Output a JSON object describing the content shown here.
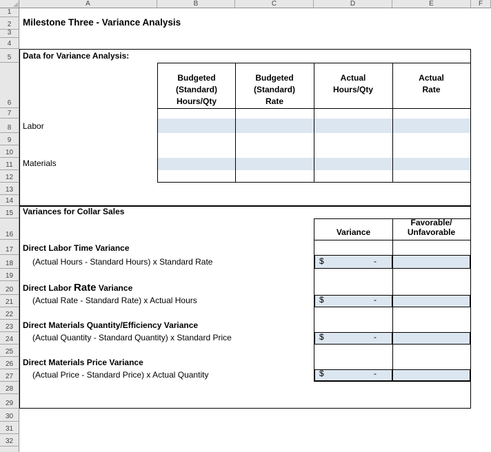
{
  "sheet": {
    "column_headers": [
      "A",
      "B",
      "C",
      "D",
      "E",
      "F"
    ],
    "row_headers": [
      "1",
      "2",
      "3",
      "4",
      "5",
      "6",
      "7",
      "8",
      "9",
      "10",
      "11",
      "12",
      "13",
      "14",
      "15",
      "16",
      "17",
      "18",
      "19",
      "20",
      "21",
      "22",
      "23",
      "24",
      "25",
      "26",
      "27",
      "28",
      "29",
      "30",
      "31",
      "32"
    ]
  },
  "title": "Milestone Three - Variance Analysis",
  "colors": {
    "input_fill": "#dce6f1",
    "header_fill": "#e7e7e7",
    "table_border": "#000000"
  },
  "data_section": {
    "heading": "Data for Variance Analysis:",
    "columns": [
      {
        "lines": [
          "Budgeted",
          "(Standard)",
          "Hours/Qty"
        ]
      },
      {
        "lines": [
          "Budgeted",
          "(Standard)",
          "Rate"
        ]
      },
      {
        "lines": [
          "Actual",
          "Hours/Qty"
        ]
      },
      {
        "lines": [
          "Actual",
          "Rate"
        ]
      }
    ],
    "rows": [
      {
        "label": "Labor"
      },
      {
        "label": "Materials"
      }
    ]
  },
  "variances_section": {
    "heading": "Variances for Collar Sales",
    "variance_header": "Variance",
    "favorable_header_line1": "Favorable/",
    "favorable_header_line2": "Unfavorable",
    "items": [
      {
        "name": "Direct Labor Time Variance",
        "formula": "(Actual Hours - Standard Hours) x Standard Rate",
        "currency": "$",
        "amount": "-",
        "favorable": ""
      },
      {
        "name_pre": "Direct Labor ",
        "name_emph": "Rate",
        "name_post": " Variance",
        "formula": "(Actual Rate - Standard Rate) x Actual Hours",
        "currency": "$",
        "amount": "-",
        "favorable": ""
      },
      {
        "name": "Direct Materials Quantity/Efficiency Variance",
        "formula": "(Actual Quantity - Standard Quantity) x Standard Price",
        "currency": "$",
        "amount": "-",
        "favorable": ""
      },
      {
        "name": "Direct Materials Price Variance",
        "formula": "(Actual Price - Standard Price) x Actual Quantity",
        "currency": "$",
        "amount": "-",
        "favorable": ""
      }
    ]
  }
}
